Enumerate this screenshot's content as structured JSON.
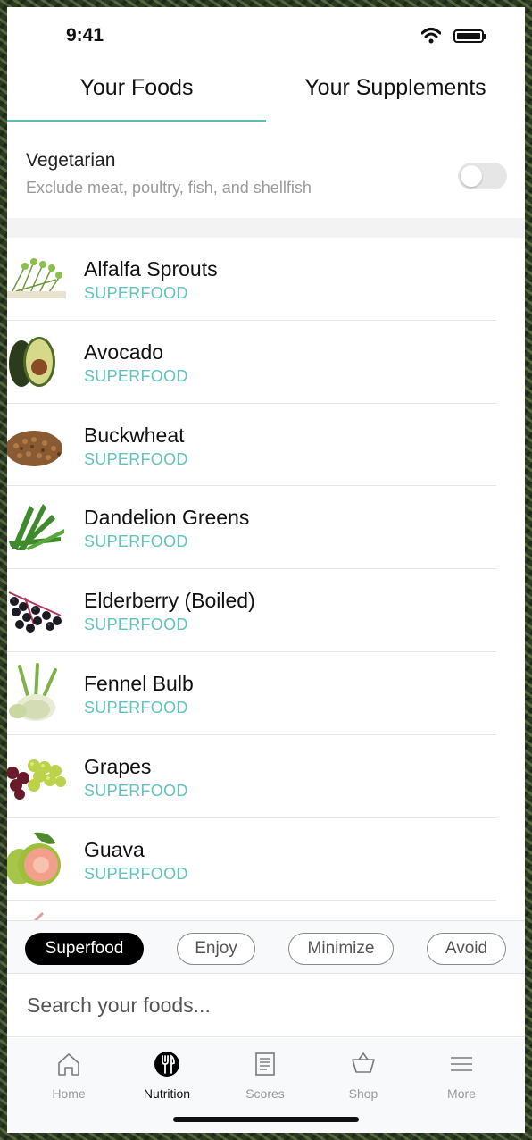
{
  "status_bar": {
    "time": "9:41"
  },
  "tabs": [
    {
      "label": "Your Foods",
      "active": true
    },
    {
      "label": "Your Supplements",
      "active": false
    }
  ],
  "vegetarian": {
    "title": "Vegetarian",
    "subtitle": "Exclude meat, poultry, fish, and shellfish",
    "enabled": false
  },
  "foods": [
    {
      "name": "Alfalfa Sprouts",
      "tag": "SUPERFOOD"
    },
    {
      "name": "Avocado",
      "tag": "SUPERFOOD"
    },
    {
      "name": "Buckwheat",
      "tag": "SUPERFOOD"
    },
    {
      "name": "Dandelion Greens",
      "tag": "SUPERFOOD"
    },
    {
      "name": "Elderberry (Boiled)",
      "tag": "SUPERFOOD"
    },
    {
      "name": "Fennel Bulb",
      "tag": "SUPERFOOD"
    },
    {
      "name": "Grapes",
      "tag": "SUPERFOOD"
    },
    {
      "name": "Guava",
      "tag": "SUPERFOOD"
    }
  ],
  "filters": [
    {
      "label": "Superfood",
      "active": true
    },
    {
      "label": "Enjoy",
      "active": false
    },
    {
      "label": "Minimize",
      "active": false
    },
    {
      "label": "Avoid",
      "active": false
    }
  ],
  "search": {
    "placeholder": "Search your foods..."
  },
  "nav": [
    {
      "label": "Home",
      "icon": "home-icon",
      "active": false
    },
    {
      "label": "Nutrition",
      "icon": "fork-icon",
      "active": true
    },
    {
      "label": "Scores",
      "icon": "document-icon",
      "active": false
    },
    {
      "label": "Shop",
      "icon": "basket-icon",
      "active": false
    },
    {
      "label": "More",
      "icon": "menu-icon",
      "active": false
    }
  ],
  "colors": {
    "accent": "#5fc4bd",
    "active_chip": "#000000"
  }
}
